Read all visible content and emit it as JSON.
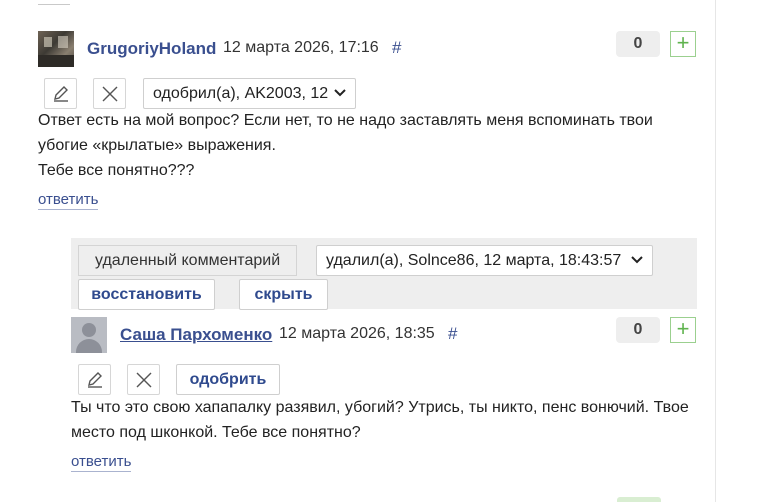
{
  "comment1": {
    "username": "GrugoriyHoland",
    "date": "12 марта 2026, 17:16",
    "hash": "#",
    "votes": "0",
    "plus": "+",
    "status_select": "одобрил(а), AK2003, 12",
    "text_lines": [
      "Ответ есть на мой вопрос? Если нет, то не надо заставлять меня вспоминать твои",
      "убогие «крылатые» выражения.",
      "Тебе все понятно???"
    ],
    "reply_label": "ответить"
  },
  "deleted_panel": {
    "tag": "удаленный комментарий",
    "status_select": "удалил(а), Solnce86, 12 марта, 18:43:57",
    "restore_label": "восстановить",
    "hide_label": "скрыть"
  },
  "comment2": {
    "username": "Саша Пархоменко",
    "date": "12 марта 2026, 18:35",
    "hash": "#",
    "votes": "0",
    "plus": "+",
    "approve_label": "одобрить",
    "text_lines": [
      "Ты что это свою хапапалку разявил, убогий? Утрись, ты никто, пенс вонючий. Твое",
      "место под шконкой. Тебе все понятно?"
    ],
    "reply_label": "ответить"
  },
  "icons": {
    "edit": "pencil-icon",
    "delete": "close-icon",
    "dropdown": "chevron-down-icon"
  },
  "colors": {
    "link": "#3a4f8f",
    "accent_green": "#5fb34e",
    "panel_gray": "#eeeeee"
  }
}
